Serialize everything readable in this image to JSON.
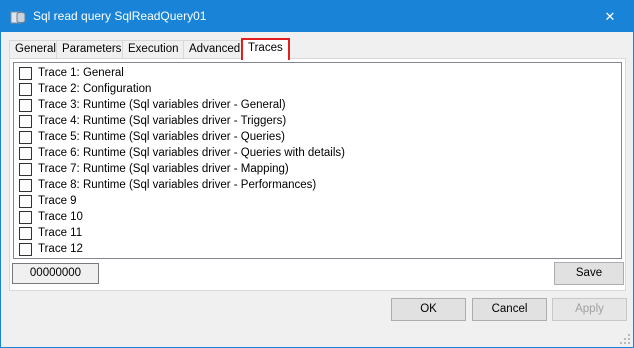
{
  "window": {
    "title": "Sql read query SqlReadQuery01",
    "close_glyph": "✕",
    "icon": "database-icon"
  },
  "tabs": [
    {
      "label": "General"
    },
    {
      "label": "Parameters"
    },
    {
      "label": "Execution"
    },
    {
      "label": "Advanced"
    },
    {
      "label": "Traces",
      "active": true
    }
  ],
  "traces": [
    {
      "label": "Trace 1: General",
      "checked": false
    },
    {
      "label": "Trace 2: Configuration",
      "checked": false
    },
    {
      "label": "Trace 3: Runtime (Sql variables driver - General)",
      "checked": false
    },
    {
      "label": "Trace 4: Runtime (Sql variables driver - Triggers)",
      "checked": false
    },
    {
      "label": "Trace 5: Runtime (Sql variables driver - Queries)",
      "checked": false
    },
    {
      "label": "Trace 6: Runtime (Sql variables driver - Queries with details)",
      "checked": false
    },
    {
      "label": "Trace 7: Runtime (Sql variables driver - Mapping)",
      "checked": false
    },
    {
      "label": "Trace 8: Runtime (Sql variables driver - Performances)",
      "checked": false
    },
    {
      "label": "Trace 9",
      "checked": false
    },
    {
      "label": "Trace 10",
      "checked": false
    },
    {
      "label": "Trace 11",
      "checked": false
    },
    {
      "label": "Trace 12",
      "checked": false
    }
  ],
  "trace_mask": {
    "value": "00000000"
  },
  "buttons": {
    "save": "Save",
    "ok": "OK",
    "cancel": "Cancel",
    "apply": "Apply"
  },
  "colors": {
    "titlebar": "#1883d7",
    "active_tab_highlight": "#e02020"
  }
}
